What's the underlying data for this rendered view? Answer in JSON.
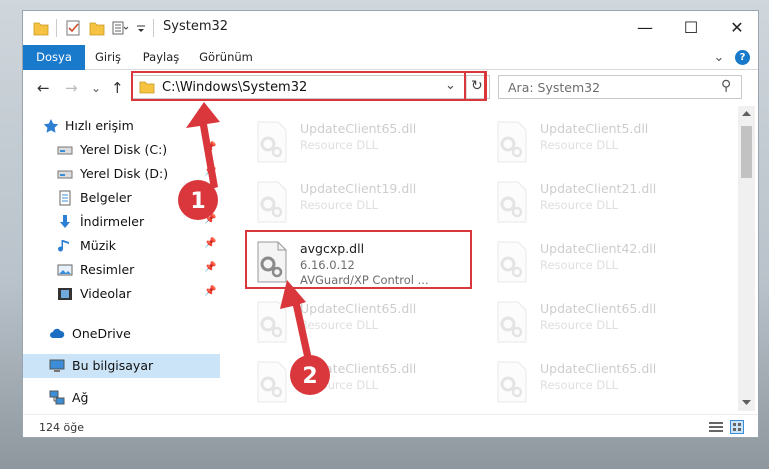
{
  "window": {
    "title": "System32",
    "controls": {
      "minimize": "—",
      "maximize": "☐",
      "close": "✕"
    }
  },
  "ribbon": {
    "tabs": [
      "Dosya",
      "Giriş",
      "Paylaş",
      "Görünüm"
    ],
    "collapse_glyph": "⌄",
    "help_glyph": "?"
  },
  "navigation": {
    "back": "←",
    "forward": "→",
    "recent": "⌄",
    "up": "↑"
  },
  "address": {
    "path": "C:\\Windows\\System32",
    "dropdown_glyph": "⌄",
    "refresh_glyph": "↻"
  },
  "search": {
    "placeholder": "Ara: System32",
    "glyph": "⚲"
  },
  "sidebar": {
    "items": [
      {
        "label": "Hızlı erişim",
        "icon": "star-icon"
      },
      {
        "label": "Yerel Disk (C:)",
        "icon": "drive-icon",
        "pinned": true
      },
      {
        "label": "Yerel Disk (D:)",
        "icon": "drive-icon",
        "pinned": true
      },
      {
        "label": "Belgeler",
        "icon": "documents-icon"
      },
      {
        "label": "İndirmeler",
        "icon": "download-icon",
        "pinned": true
      },
      {
        "label": "Müzik",
        "icon": "music-icon",
        "pinned": true
      },
      {
        "label": "Resimler",
        "icon": "pictures-icon",
        "pinned": true
      },
      {
        "label": "Videolar",
        "icon": "videos-icon",
        "pinned": true
      },
      {
        "label": "OneDrive",
        "icon": "cloud-icon"
      },
      {
        "label": "Bu bilgisayar",
        "icon": "computer-icon",
        "selected": true
      },
      {
        "label": "Ağ",
        "icon": "network-icon"
      }
    ],
    "pin_glyph": "📌"
  },
  "files": [
    {
      "name": "UpdateClient65.dll",
      "type": "Resource DLL"
    },
    {
      "name": "UpdateClient5.dll",
      "type": "Resource DLL"
    },
    {
      "name": "UpdateClient19.dll",
      "type": "Resource DLL"
    },
    {
      "name": "UpdateClient21.dll",
      "type": "Resource DLL"
    },
    {
      "name": "avgcxp.dll",
      "version": "6.16.0.12",
      "description": "AVGuard/XP Control ...",
      "highlighted": true
    },
    {
      "name": "UpdateClient42.dll",
      "type": "Resource DLL"
    },
    {
      "name": "UpdateClient65.dll",
      "type": "Resource DLL"
    },
    {
      "name": "UpdateClient65.dll",
      "type": "Resource DLL"
    },
    {
      "name": "UpdateClient65.dll",
      "type": "Resource DLL"
    },
    {
      "name": "UpdateClient65.dll",
      "type": "Resource DLL"
    }
  ],
  "status": {
    "item_count": "124 öğe"
  },
  "callouts": [
    {
      "number": "1",
      "target": "address-bar"
    },
    {
      "number": "2",
      "target": "avgcxp.dll"
    }
  ],
  "colors": {
    "accent": "#1979ca",
    "highlight": "#d9373c",
    "selection": "#cce4f7"
  }
}
